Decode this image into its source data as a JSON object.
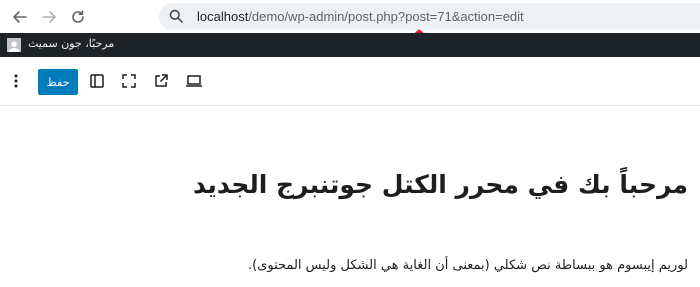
{
  "browser": {
    "back_icon": "arrow-left-icon",
    "forward_icon": "arrow-right-icon",
    "reload_icon": "reload-icon",
    "url_host": "localhost",
    "url_path": "/demo/wp-admin/post.php?post=71&action=edit"
  },
  "annotation": {
    "color": "#e8173c"
  },
  "admin_bar": {
    "greeting": "مرحبًا، جون سميث",
    "background": "#1d2327"
  },
  "toolbar": {
    "options_icon": "more-vertical-icon",
    "save_label": "حفظ",
    "save_color": "#007cba",
    "sidebar_icon": "sidebar-toggle-icon",
    "fullscreen_icon": "fullscreen-icon",
    "external_icon": "external-link-icon",
    "preview_icon": "desktop-preview-icon"
  },
  "editor": {
    "title": "مرحباً بك في محرر الكتل جوتنبرج الجديد",
    "paragraph": "لوريم إيبسوم هو ببساطة نص شكلي (بمعنى أن الغاية هي الشكل وليس المحتوى)."
  }
}
